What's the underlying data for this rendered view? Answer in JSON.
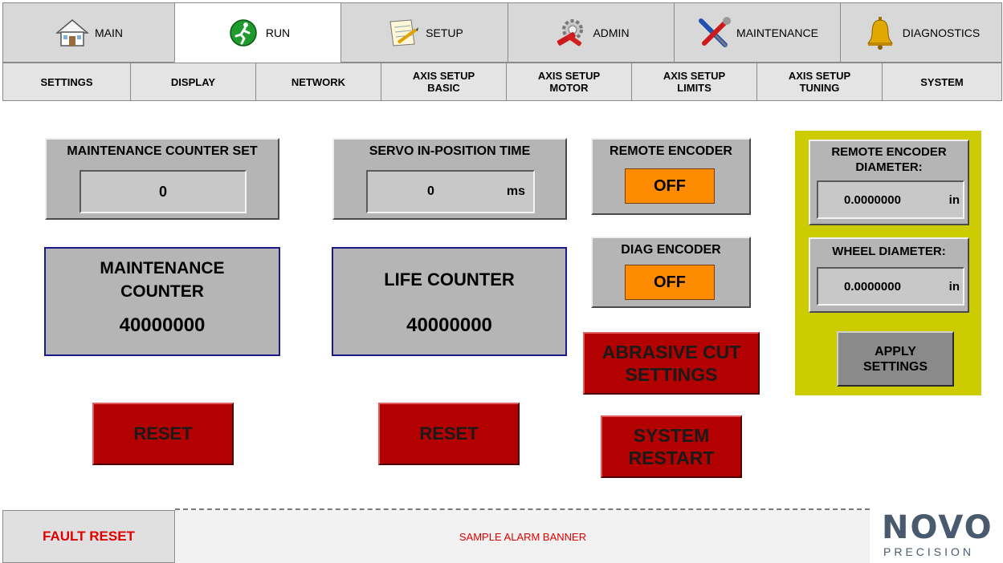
{
  "top_tabs": [
    {
      "label": "MAIN",
      "icon": "house-icon"
    },
    {
      "label": "RUN",
      "icon": "runner-icon"
    },
    {
      "label": "SETUP",
      "icon": "notepad-icon"
    },
    {
      "label": "ADMIN",
      "icon": "tools-gear-icon"
    },
    {
      "label": "MAINTENANCE",
      "icon": "screwdriver-wrench-icon"
    },
    {
      "label": "DIAGNOSTICS",
      "icon": "bell-icon"
    }
  ],
  "sub_tabs": [
    {
      "line1": "SETTINGS",
      "line2": ""
    },
    {
      "line1": "DISPLAY",
      "line2": ""
    },
    {
      "line1": "NETWORK",
      "line2": ""
    },
    {
      "line1": "AXIS SETUP",
      "line2": "BASIC"
    },
    {
      "line1": "AXIS SETUP",
      "line2": "MOTOR"
    },
    {
      "line1": "AXIS SETUP",
      "line2": "LIMITS"
    },
    {
      "line1": "AXIS SETUP",
      "line2": "TUNING"
    },
    {
      "line1": "SYSTEM",
      "line2": ""
    }
  ],
  "maint_counter_set": {
    "title": "MAINTENANCE COUNTER SET",
    "value": "0"
  },
  "servo_in_position": {
    "title": "SERVO IN-POSITION TIME",
    "value": "0",
    "unit": "ms"
  },
  "remote_encoder": {
    "title": "REMOTE ENCODER",
    "state": "OFF"
  },
  "diag_encoder": {
    "title": "DIAG ENCODER",
    "state": "OFF"
  },
  "maintenance_counter": {
    "line1": "MAINTENANCE",
    "line2": "COUNTER",
    "value": "40000000"
  },
  "life_counter": {
    "title": "LIFE COUNTER",
    "value": "40000000"
  },
  "abrasive_cut": {
    "line1": "ABRASIVE CUT",
    "line2": "SETTINGS"
  },
  "system_restart": {
    "line1": "SYSTEM",
    "line2": "RESTART"
  },
  "reset_label": "RESET",
  "encoder_panel": {
    "remote_title_1": "REMOTE ENCODER",
    "remote_title_2": "DIAMETER:",
    "remote_value": "0.0000000",
    "remote_unit": "in",
    "wheel_title": "WHEEL DIAMETER:",
    "wheel_value": "0.0000000",
    "wheel_unit": "in",
    "apply_1": "APPLY",
    "apply_2": "SETTINGS",
    "bg_color": "#cccc00"
  },
  "footer": {
    "fault_reset": "FAULT RESET",
    "alarm_banner": "SAMPLE ALARM BANNER"
  },
  "logo": {
    "name": "NOVO",
    "sub": "PRECISION"
  },
  "colors": {
    "red_button": "#b30000",
    "orange_toggle": "#ff8c00",
    "panel_grey": "#b5b5b5",
    "alarm_text": "#e00000"
  }
}
